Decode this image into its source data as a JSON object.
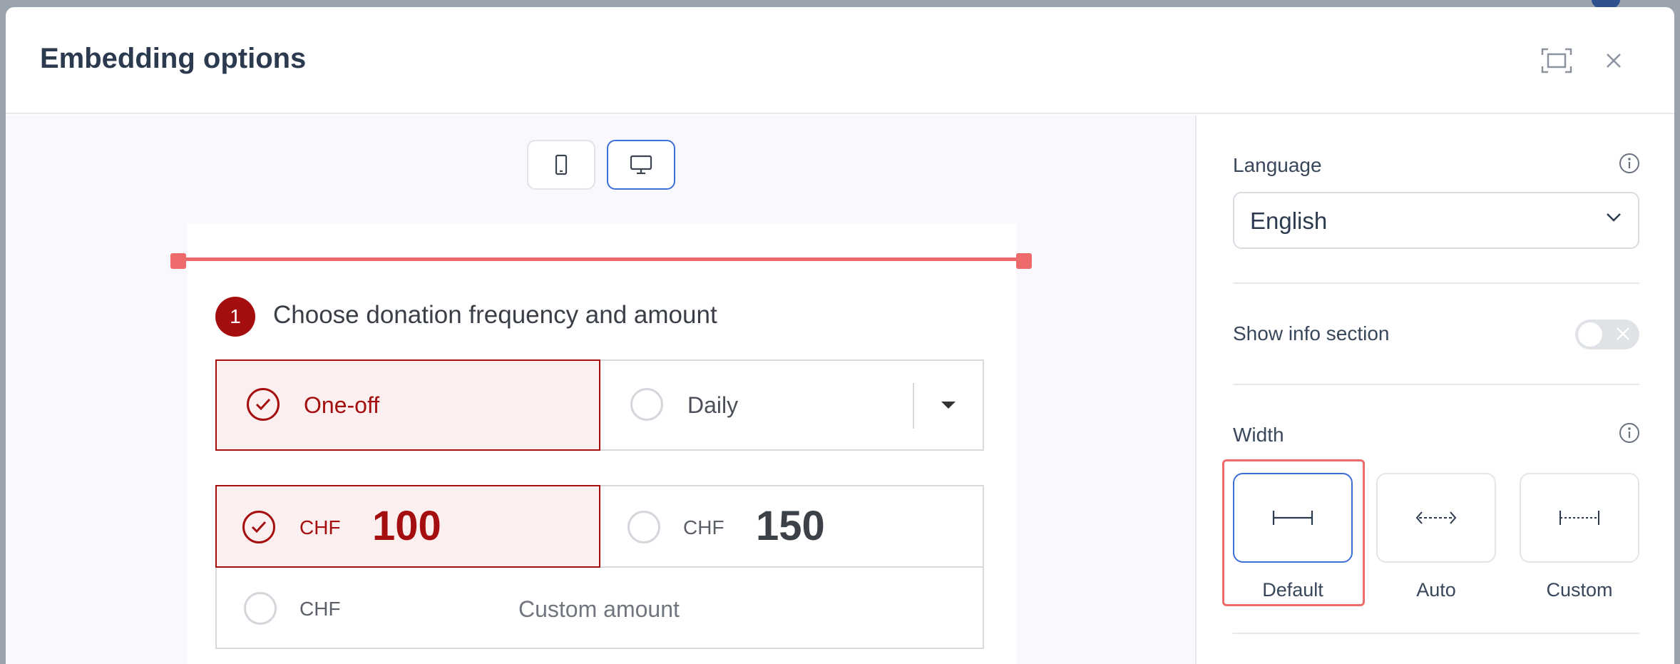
{
  "modal": {
    "title": "Embedding options"
  },
  "preview": {
    "step": {
      "number": "1",
      "title": "Choose donation frequency and amount"
    },
    "frequency": {
      "selected": "One-off",
      "options": [
        "One-off",
        "Daily"
      ]
    },
    "amounts": {
      "currency": "CHF",
      "options": [
        "100",
        "150"
      ],
      "custom_placeholder": "Custom amount"
    }
  },
  "settings": {
    "language": {
      "label": "Language",
      "value": "English"
    },
    "info_section": {
      "label": "Show info section",
      "enabled": false
    },
    "width": {
      "label": "Width",
      "options": [
        "Default",
        "Auto",
        "Custom"
      ],
      "selected": "Default"
    }
  },
  "colors": {
    "accent_red": "#a50e0e",
    "selection_blue": "#3d6dd6",
    "highlight": "#ee6b6b"
  }
}
